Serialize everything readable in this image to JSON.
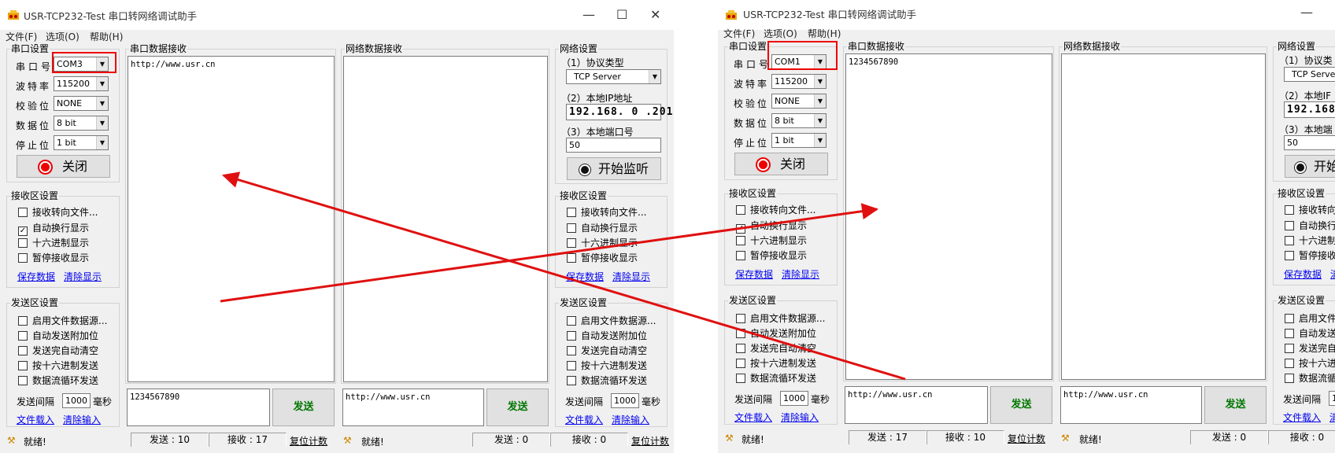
{
  "left": {
    "title": "USR-TCP232-Test 串口转网络调试助手",
    "menu": [
      "文件(F)",
      "选项(O)",
      "帮助(H)"
    ],
    "serial": {
      "group": "串口设置",
      "port_label": "串口号",
      "port_value": "COM3",
      "baud_label": "波特率",
      "baud_value": "115200",
      "parity_label": "校验位",
      "parity_value": "NONE",
      "data_label": "数据位",
      "data_value": "8 bit",
      "stop_label": "停止位",
      "stop_value": "1 bit",
      "open_button": "关闭"
    },
    "recv_settings": {
      "group": "接收区设置",
      "items": [
        {
          "label": "接收转向文件...",
          "checked": false
        },
        {
          "label": "自动换行显示",
          "checked": true
        },
        {
          "label": "十六进制显示",
          "checked": false
        },
        {
          "label": "暂停接收显示",
          "checked": false
        }
      ],
      "save": "保存数据",
      "clear": "清除显示"
    },
    "send_settings": {
      "group": "发送区设置",
      "items": [
        {
          "label": "启用文件数据源...",
          "checked": false
        },
        {
          "label": "自动发送附加位",
          "checked": false
        },
        {
          "label": "发送完自动清空",
          "checked": false
        },
        {
          "label": "按十六进制发送",
          "checked": false
        },
        {
          "label": "数据流循环发送",
          "checked": false
        }
      ],
      "interval_label": "发送间隔",
      "interval_value": "1000",
      "interval_unit": "毫秒",
      "load": "文件载入",
      "clear": "清除输入"
    },
    "serial_recv": {
      "group": "串口数据接收",
      "content": "http://www.usr.cn"
    },
    "net_recv": {
      "group": "网络数据接收",
      "content": ""
    },
    "serial_send": {
      "content": "1234567890",
      "button": "发送"
    },
    "net_send": {
      "content": "http://www.usr.cn",
      "button": "发送"
    },
    "net_settings": {
      "group": "网络设置",
      "proto_label": "（1）协议类型",
      "proto_value": "TCP Server",
      "ip_label": "（2）本地IP地址",
      "ip_value": "192.168. 0 .201",
      "port_label": "（3）本地端口号",
      "port_value": "50",
      "listen_button": "开始监听"
    },
    "net_recv_settings": {
      "group": "接收区设置",
      "items": [
        {
          "label": "接收转向文件...",
          "checked": false
        },
        {
          "label": "自动换行显示",
          "checked": false
        },
        {
          "label": "十六进制显示",
          "checked": false
        },
        {
          "label": "暂停接收显示",
          "checked": false
        }
      ],
      "save": "保存数据",
      "clear": "清除显示"
    },
    "net_send_settings": {
      "group": "发送区设置",
      "items": [
        {
          "label": "启用文件数据源...",
          "checked": false
        },
        {
          "label": "自动发送附加位",
          "checked": false
        },
        {
          "label": "发送完自动清空",
          "checked": false
        },
        {
          "label": "按十六进制发送",
          "checked": false
        },
        {
          "label": "数据流循环发送",
          "checked": false
        }
      ],
      "interval_label": "发送间隔",
      "interval_value": "1000",
      "interval_unit": "毫秒",
      "load": "文件载入",
      "clear": "清除输入"
    },
    "status": {
      "ready1": "就绪!",
      "sent1": "发送 : 10",
      "recv1": "接收 : 17",
      "reset1": "复位计数",
      "ready2": "就绪!",
      "sent2": "发送 : 0",
      "recv2": "接收 : 0",
      "reset2": "复位计数"
    }
  },
  "right": {
    "title": "USR-TCP232-Test 串口转网络调试助手",
    "menu": [
      "文件(F)",
      "选项(O)",
      "帮助(H)"
    ],
    "serial": {
      "group": "串口设置",
      "port_label": "串口号",
      "port_value": "COM1",
      "baud_label": "波特率",
      "baud_value": "115200",
      "parity_label": "校验位",
      "parity_value": "NONE",
      "data_label": "数据位",
      "data_value": "8 bit",
      "stop_label": "停止位",
      "stop_value": "1 bit",
      "open_button": "关闭"
    },
    "recv_settings": {
      "group": "接收区设置",
      "items": [
        {
          "label": "接收转向文件...",
          "checked": false
        },
        {
          "label": "自动换行显示",
          "checked": true
        },
        {
          "label": "十六进制显示",
          "checked": false
        },
        {
          "label": "暂停接收显示",
          "checked": false
        }
      ],
      "save": "保存数据",
      "clear": "清除显示"
    },
    "send_settings": {
      "group": "发送区设置",
      "items": [
        {
          "label": "启用文件数据源...",
          "checked": false
        },
        {
          "label": "自动发送附加位",
          "checked": false
        },
        {
          "label": "发送完自动清空",
          "checked": false
        },
        {
          "label": "按十六进制发送",
          "checked": false
        },
        {
          "label": "数据流循环发送",
          "checked": false
        }
      ],
      "interval_label": "发送间隔",
      "interval_value": "1000",
      "interval_unit": "毫秒",
      "load": "文件载入",
      "clear": "清除输入"
    },
    "serial_recv": {
      "group": "串口数据接收",
      "content": "1234567890"
    },
    "net_recv": {
      "group": "网络数据接收",
      "content": ""
    },
    "serial_send": {
      "content": "http://www.usr.cn",
      "button": "发送"
    },
    "net_send": {
      "content": "http://www.usr.cn",
      "button": "发送"
    },
    "net_settings": {
      "group": "网络设置",
      "proto_label": "（1）协议类",
      "proto_value": "TCP Server",
      "ip_label": "（2）本地IF",
      "ip_value": "192.168.",
      "port_label": "（3）本地端",
      "port_value": "50",
      "listen_button": "开始"
    },
    "net_recv_settings": {
      "group": "接收区设置",
      "items": [
        {
          "label": "接收转向",
          "checked": false
        },
        {
          "label": "自动换行",
          "checked": false
        },
        {
          "label": "十六进制",
          "checked": false
        },
        {
          "label": "暂停接收",
          "checked": false
        }
      ],
      "save": "保存数据",
      "clear": "清"
    },
    "net_send_settings": {
      "group": "发送区设置",
      "items": [
        {
          "label": "启用文件",
          "checked": false
        },
        {
          "label": "自动发送",
          "checked": false
        },
        {
          "label": "发送完自",
          "checked": false
        },
        {
          "label": "按十六进",
          "checked": false
        },
        {
          "label": "数据流循",
          "checked": false
        }
      ],
      "interval_label": "发送间隔",
      "interval_value": "1",
      "interval_unit": "",
      "load": "文件载入",
      "clear": "清"
    },
    "status": {
      "ready1": "就绪!",
      "sent1": "发送 : 17",
      "recv1": "接收 : 10",
      "reset1": "复位计数",
      "ready2": "就绪!",
      "sent2": "发送 : 0",
      "recv2": "接收 : 0",
      "reset2": ""
    }
  }
}
